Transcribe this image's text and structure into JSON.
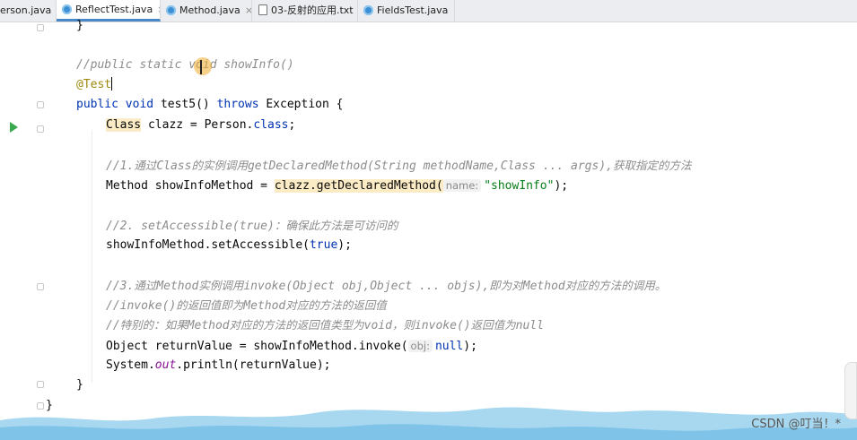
{
  "tabs": [
    {
      "label": "erson.java",
      "icon": "java-class-icon",
      "active": false,
      "closable": false
    },
    {
      "label": "ReflectTest.java",
      "icon": "java-class-icon",
      "active": true,
      "closable": true
    },
    {
      "label": "Method.java",
      "icon": "java-class-icon",
      "active": false,
      "closable": true
    },
    {
      "label": "03-反射的应用.txt",
      "icon": "text-file-icon",
      "active": false,
      "closable": true
    },
    {
      "label": "FieldsTest.java",
      "icon": "java-class-icon",
      "active": false,
      "closable": true
    }
  ],
  "close_glyph": "×",
  "code": {
    "brace_top": "}",
    "comment_signature": "//public static void showInfo()",
    "annotation": "@Test",
    "sig_public": "public ",
    "sig_void": "void ",
    "sig_name": "test5() ",
    "sig_throws": "throws ",
    "sig_rest": "Exception {",
    "clazz_type": "Class",
    "clazz_rest": " clazz = Person.",
    "clazz_class_kw": "class",
    "clazz_end": ";",
    "comment1_a": "//1.",
    "comment1_b": "通过",
    "comment1_c": "Class",
    "comment1_d": "的实例调用",
    "comment1_e": "getDeclaredMethod(String methodName,Class ... args),",
    "comment1_f": "获取指定的方法",
    "method_decl": "Method showInfoMethod = ",
    "method_call": "clazz.getDeclaredMethod(",
    "method_hint": "name:",
    "method_arg": "\"showInfo\"",
    "method_end": ");",
    "comment2_a": "//2. setAccessible(true)",
    "comment2_b": "：确保此方法是可访问的",
    "setacc_a": "showInfoMethod.setAccessible(",
    "setacc_true": "true",
    "setacc_end": ");",
    "comment3_a": "//3.",
    "comment3_b": "通过",
    "comment3_c": "Method",
    "comment3_d": "实例调用",
    "comment3_e": "invoke(Object obj,Object ... objs),",
    "comment3_f": "即为对",
    "comment3_g": "Method",
    "comment3_h": "对应的方法的调用。",
    "comment4_a": "//invoke()",
    "comment4_b": "的返回值即为",
    "comment4_c": "Method",
    "comment4_d": "对应的方法的返回值",
    "comment5_a": "//",
    "comment5_b": "特别的：如果",
    "comment5_c": "Method",
    "comment5_d": "对应的方法的返回值类型为",
    "comment5_e": "void",
    "comment5_f": "，则",
    "comment5_g": "invoke()",
    "comment5_h": "返回值为",
    "comment5_i": "null",
    "invoke_decl": "Object returnValue = showInfoMethod.invoke(",
    "invoke_hint": "obj:",
    "invoke_null": "null",
    "invoke_end": ");",
    "println_a": "System.",
    "println_out": "out",
    "println_b": ".println(returnValue);",
    "brace_method": "}",
    "brace_class": "}"
  },
  "watermark": "CSDN @叮当！*",
  "colors": {
    "keyword": "#0033b3",
    "comment": "#8c8c8c",
    "annotation": "#9e880d",
    "string": "#067d17",
    "field": "#871094",
    "highlight": "#fcecc6",
    "run_arrow": "#3aa84c",
    "active_tab_underline": "#4a88c7"
  }
}
